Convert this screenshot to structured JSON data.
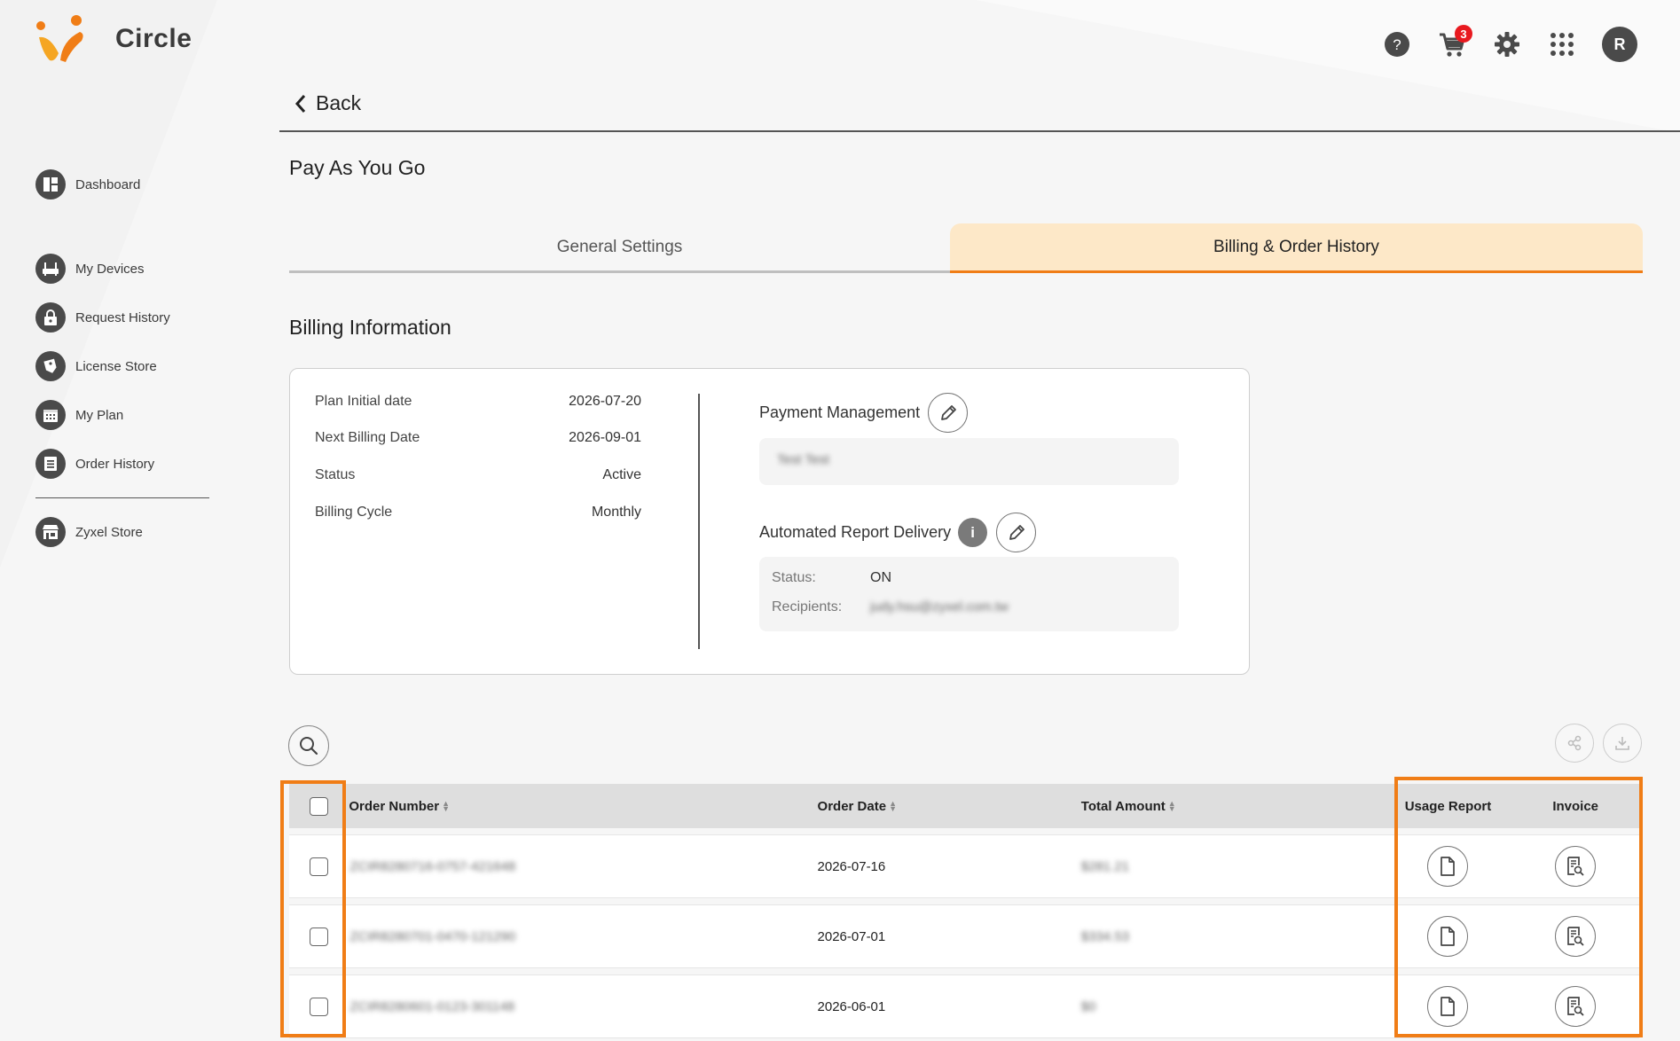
{
  "app": {
    "name": "Circle",
    "brand_color": "#f07d16"
  },
  "header": {
    "help_icon": "help-icon",
    "cart": {
      "icon": "cart-icon",
      "badge_count": "3"
    },
    "settings_icon": "gear-icon",
    "apps_icon": "apps-grid-icon",
    "avatar_initial": "R"
  },
  "sidebar": {
    "items": [
      {
        "label": "Dashboard",
        "icon": "dashboard-icon"
      },
      {
        "label": "My Devices",
        "icon": "router-icon"
      },
      {
        "label": "Request History",
        "icon": "lock-icon"
      },
      {
        "label": "License Store",
        "icon": "tag-icon"
      },
      {
        "label": "My Plan",
        "icon": "calendar-icon"
      },
      {
        "label": "Order History",
        "icon": "list-icon"
      },
      {
        "label": "Zyxel Store",
        "icon": "store-icon"
      }
    ]
  },
  "main": {
    "back_label": "Back",
    "page_title": "Pay As You Go",
    "tabs": [
      {
        "label": "General Settings",
        "active": false
      },
      {
        "label": "Billing & Order History",
        "active": true
      }
    ],
    "section_title": "Billing Information"
  },
  "billing": {
    "rows": [
      {
        "label": "Plan Initial date",
        "value": "2026-07-20"
      },
      {
        "label": "Next Billing Date",
        "value": "2026-09-01"
      },
      {
        "label": "Status",
        "value": "Active"
      },
      {
        "label": "Billing Cycle",
        "value": "Monthly"
      }
    ],
    "payment_management": {
      "label": "Payment Management",
      "value": "Test  Test"
    },
    "report_delivery": {
      "label": "Automated Report Delivery",
      "info": "i",
      "status_label": "Status:",
      "status_value": "ON",
      "recipients_label": "Recipients:",
      "recipients_value": "judy.hsu@zyxel.com.tw"
    }
  },
  "table": {
    "columns": [
      "Order Number",
      "Order Date",
      "Total Amount",
      "Usage Report",
      "Invoice"
    ],
    "rows": [
      {
        "order_number": "ZCIR8280716-0757-421648",
        "order_date": "2026-07-16",
        "total_amount": "$281.21"
      },
      {
        "order_number": "ZCIR8280701-0470-121290",
        "order_date": "2026-07-01",
        "total_amount": "$334.53"
      },
      {
        "order_number": "ZCIR8280601-0123-301148",
        "order_date": "2026-06-01",
        "total_amount": "$0"
      }
    ]
  }
}
